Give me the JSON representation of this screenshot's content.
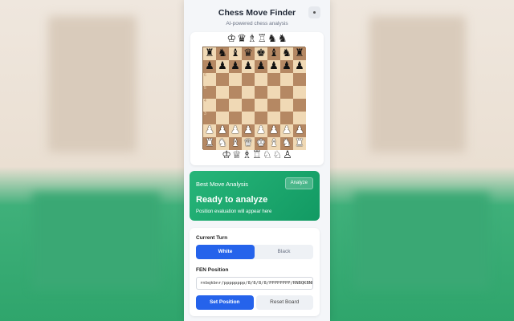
{
  "header": {
    "title": "Chess Move Finder",
    "subtitle": "AI-powered chess analysis"
  },
  "board": {
    "captured_top": [
      "♔",
      "♛",
      "♗",
      "♖",
      "♞",
      "♞"
    ],
    "captured_bottom": [
      "♔",
      "♕",
      "♗",
      "♖",
      "♘",
      "♘",
      "♙"
    ],
    "ranks": [
      [
        "r",
        "n",
        "b",
        "q",
        "k",
        "b",
        "n",
        "r"
      ],
      [
        "p",
        "p",
        "p",
        "p",
        "p",
        "p",
        "p",
        "p"
      ],
      [
        "",
        "",
        "",
        "",
        "",
        "",
        "",
        ""
      ],
      [
        "",
        "",
        "",
        "",
        "",
        "",
        "",
        ""
      ],
      [
        "",
        "",
        "",
        "",
        "",
        "",
        "",
        ""
      ],
      [
        "",
        "",
        "",
        "",
        "",
        "",
        "",
        ""
      ],
      [
        "P",
        "P",
        "P",
        "P",
        "P",
        "P",
        "P",
        "P"
      ],
      [
        "R",
        "N",
        "B",
        "Q",
        "K",
        "B",
        "N",
        "R"
      ]
    ],
    "rank_labels": [
      "",
      "",
      "6",
      "5",
      "4",
      "3",
      "",
      ""
    ]
  },
  "analysis": {
    "label": "Best Move Analysis",
    "analyze_label": "Analyze",
    "status": "Ready to analyze",
    "description": "Position evaluation will appear here"
  },
  "controls": {
    "turn_label": "Current Turn",
    "white_label": "White",
    "black_label": "Black",
    "selected_turn": "White",
    "fen_label": "FEN Position",
    "fen_value": "rnbqkbnr/pppppppp/8/8/8/8/PPPPPPPP/RNBQKBNR",
    "set_position_label": "Set Position",
    "reset_label": "Reset Board"
  },
  "colors": {
    "accent_blue": "#2563eb",
    "analysis_green": "#129a63",
    "light_square": "#f0d9b5",
    "dark_square": "#b58863"
  }
}
